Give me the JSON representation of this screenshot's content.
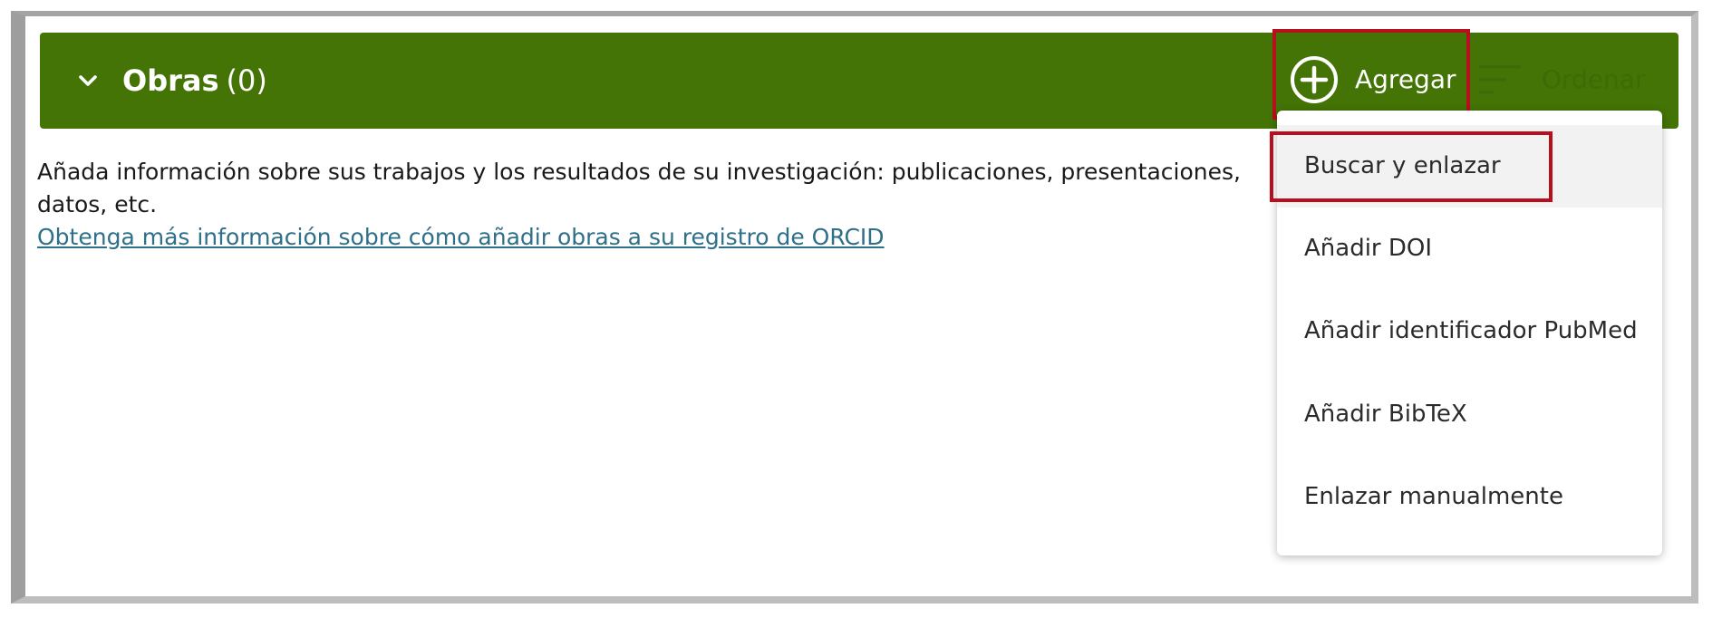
{
  "section": {
    "title": "Obras",
    "count": "(0)"
  },
  "toolbar": {
    "add_label": "Agregar",
    "sort_label": "Ordenar"
  },
  "content": {
    "description_line1": "Añada información sobre sus trabajos y los resultados de su investigación: publicaciones, presentaciones,",
    "description_line2": "datos, etc.",
    "learn_more_link": "Obtenga más información sobre cómo añadir obras a su registro de ORCID"
  },
  "add_menu": {
    "items": [
      {
        "label": "Buscar y enlazar"
      },
      {
        "label": "Añadir DOI"
      },
      {
        "label": "Añadir identificador PubMed"
      },
      {
        "label": "Añadir BibTeX"
      },
      {
        "label": "Enlazar manualmente"
      }
    ]
  },
  "colors": {
    "header_background": "#447405",
    "callout_border": "#b80f1e",
    "link": "#2e6f89"
  },
  "icons": [
    "chevron-down-icon",
    "add-circle-icon",
    "sort-icon"
  ]
}
